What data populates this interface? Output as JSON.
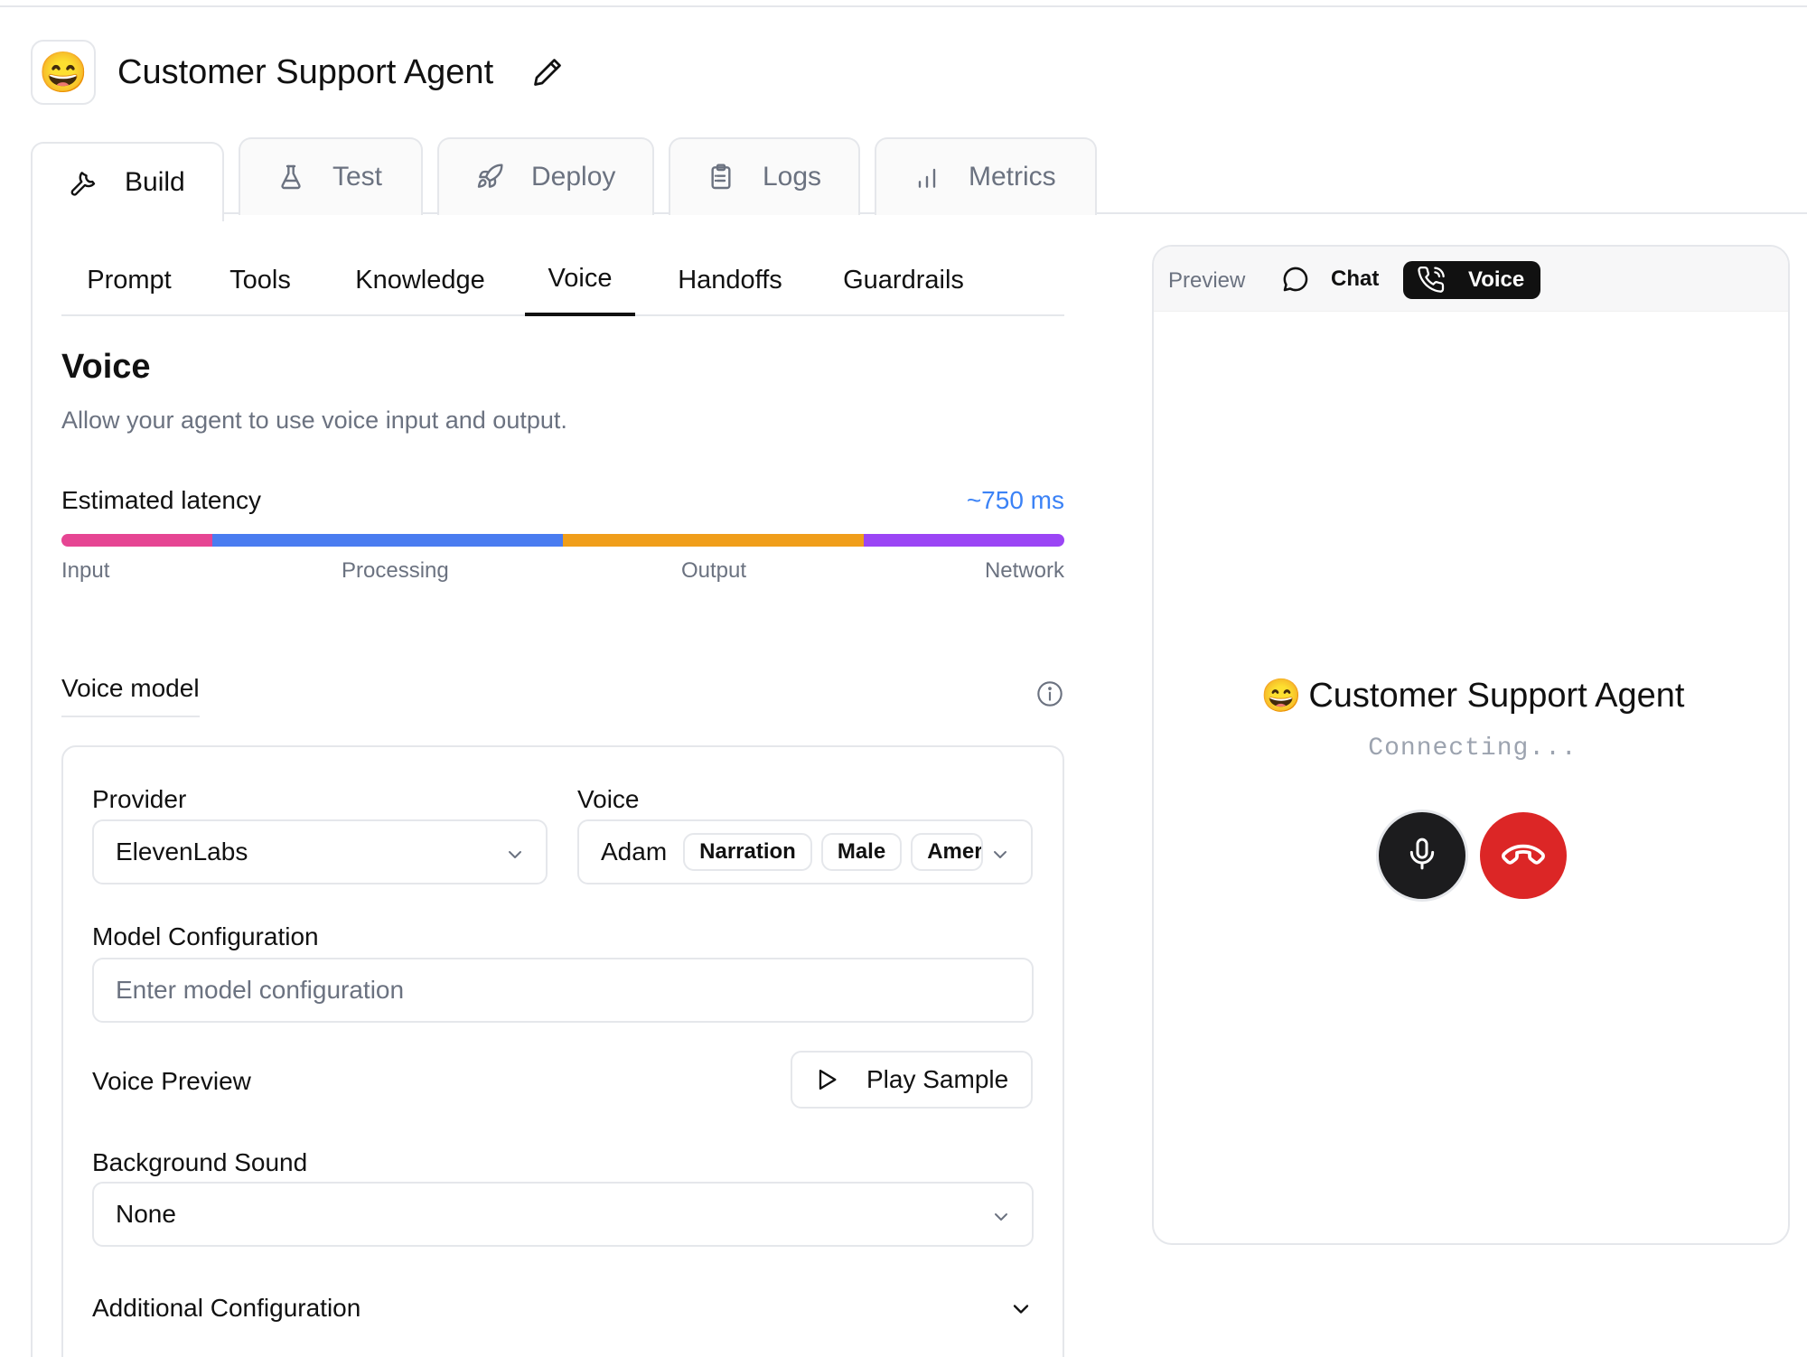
{
  "header": {
    "avatar": "😄",
    "title": "Customer Support Agent"
  },
  "main_tabs": [
    {
      "label": "Build",
      "icon": "wrench-icon",
      "active": true
    },
    {
      "label": "Test",
      "icon": "flask-icon",
      "active": false
    },
    {
      "label": "Deploy",
      "icon": "rocket-icon",
      "active": false
    },
    {
      "label": "Logs",
      "icon": "clipboard-icon",
      "active": false
    },
    {
      "label": "Metrics",
      "icon": "bar-chart-icon",
      "active": false
    }
  ],
  "sub_tabs": [
    {
      "label": "Prompt",
      "active": false
    },
    {
      "label": "Tools",
      "active": false
    },
    {
      "label": "Knowledge",
      "active": false
    },
    {
      "label": "Voice",
      "active": true
    },
    {
      "label": "Handoffs",
      "active": false
    },
    {
      "label": "Guardrails",
      "active": false
    }
  ],
  "voice": {
    "title": "Voice",
    "description": "Allow your agent to use voice input and output.",
    "latency": {
      "label": "Estimated latency",
      "value": "~750 ms",
      "segments": [
        {
          "name": "Input",
          "fraction": 0.15,
          "color": "#e64593"
        },
        {
          "name": "Processing",
          "fraction": 0.35,
          "color": "#4a7cf0"
        },
        {
          "name": "Output",
          "fraction": 0.3,
          "color": "#f09e1a"
        },
        {
          "name": "Network",
          "fraction": 0.2,
          "color": "#9b45f5"
        }
      ]
    },
    "voice_model_label": "Voice model",
    "provider": {
      "label": "Provider",
      "value": "ElevenLabs"
    },
    "voice_select": {
      "label": "Voice",
      "value": "Adam",
      "tags": [
        "Narration",
        "Male",
        "Amer"
      ]
    },
    "model_config": {
      "label": "Model Configuration",
      "placeholder": "Enter model configuration"
    },
    "voice_preview": {
      "label": "Voice Preview",
      "button": "Play Sample"
    },
    "background_sound": {
      "label": "Background Sound",
      "value": "None"
    },
    "additional_config": {
      "label": "Additional Configuration"
    }
  },
  "preview": {
    "label": "Preview",
    "chat_label": "Chat",
    "voice_label": "Voice",
    "agent_emoji": "😄",
    "agent_name": "Customer Support Agent",
    "status": "Connecting...",
    "colors": {
      "hangup": "#dc2626",
      "mic": "#1c1c1e"
    }
  }
}
